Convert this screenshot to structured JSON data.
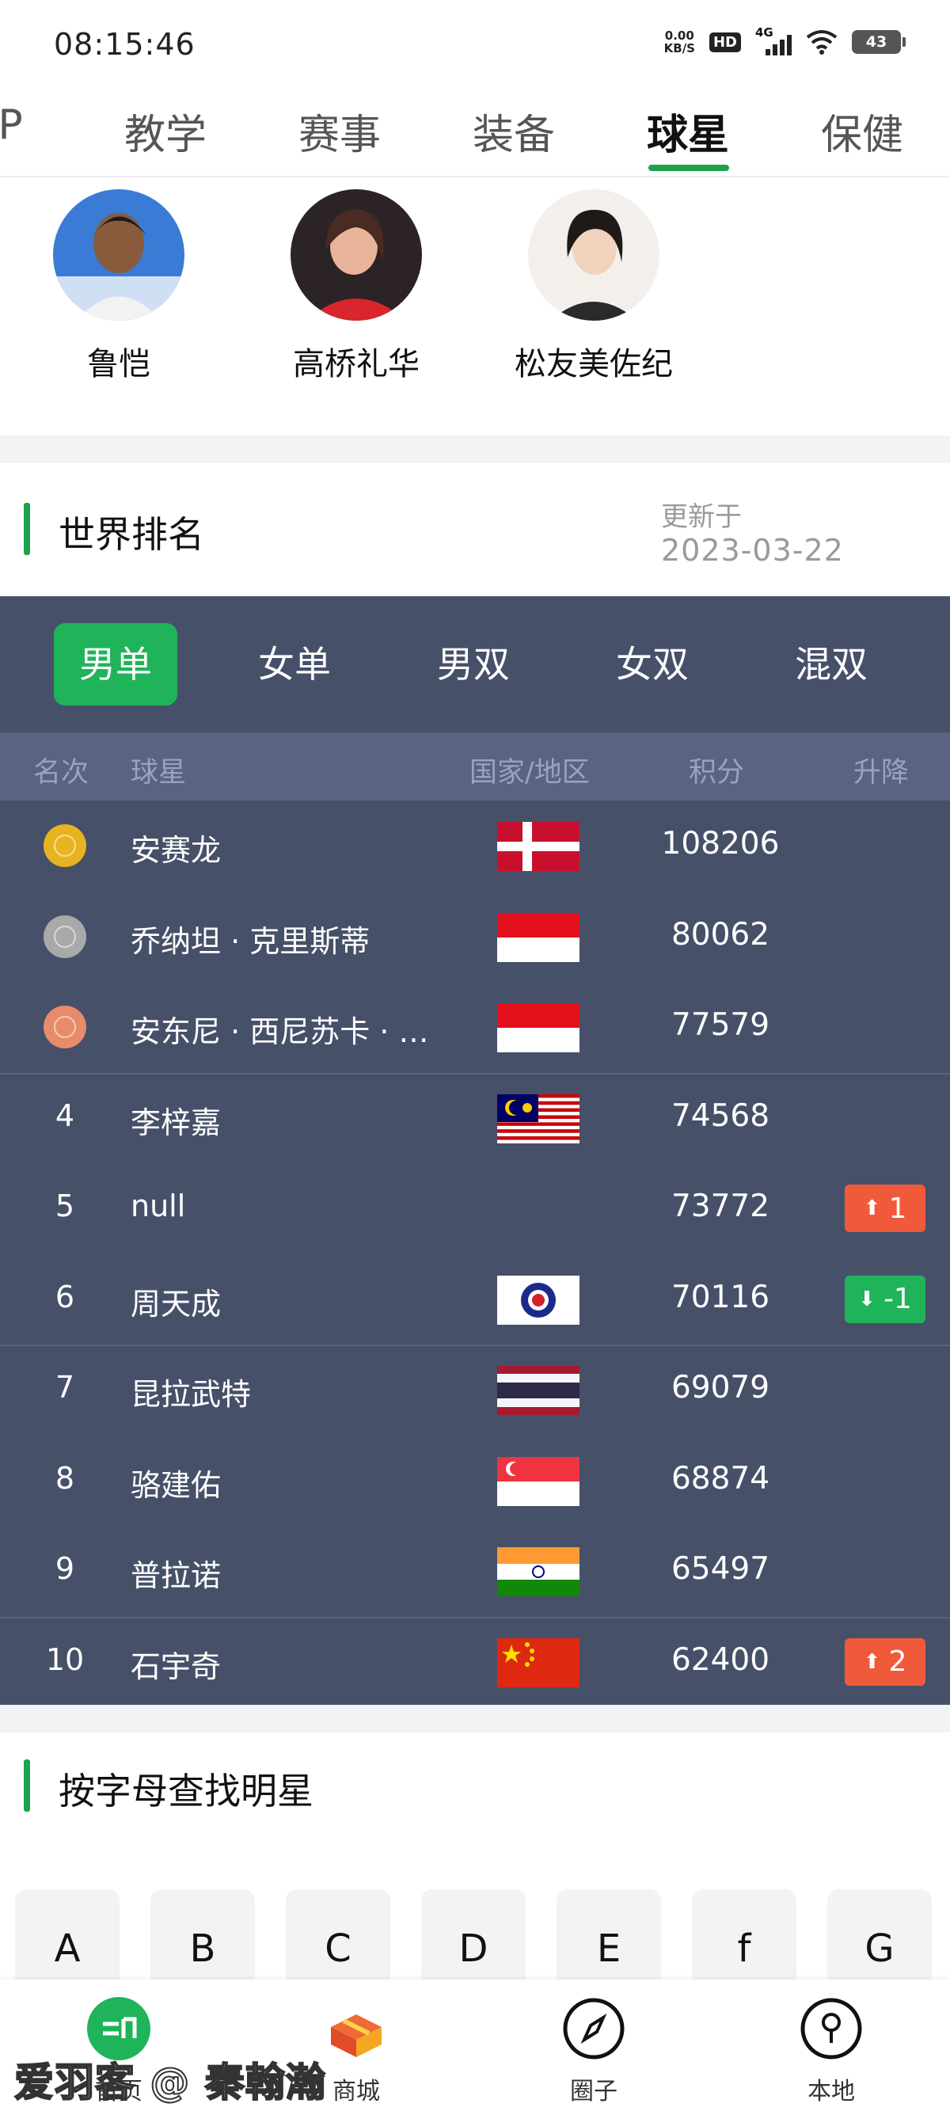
{
  "status_bar": {
    "time": "08:15:46",
    "speed_top": "0.00",
    "speed_bottom": "KB/S",
    "hd": "HD",
    "network": "4G",
    "battery": "43"
  },
  "top_tabs": [
    "IP",
    "教学",
    "赛事",
    "装备",
    "球星",
    "保健"
  ],
  "active_top_tab": "球星",
  "stars": [
    {
      "name": "鲁恺"
    },
    {
      "name": "高桥礼华"
    },
    {
      "name": "松友美佐纪"
    }
  ],
  "ranking": {
    "title": "世界排名",
    "updated_label": "更新于",
    "updated_date": "2023-03-22",
    "segments": [
      "男单",
      "女单",
      "男双",
      "女双",
      "混双"
    ],
    "active_segment": "男单",
    "columns": {
      "rank": "名次",
      "player": "球星",
      "country": "国家/地区",
      "score": "积分",
      "change": "升降"
    },
    "rows": [
      {
        "rank": "1",
        "medal": "gold",
        "name": "安赛龙",
        "flag": "denmark-flag",
        "score": "108206",
        "change": "",
        "direction": ""
      },
      {
        "rank": "2",
        "medal": "silver",
        "name": "乔纳坦 · 克里斯蒂",
        "flag": "indonesia-flag",
        "score": "80062",
        "change": "",
        "direction": ""
      },
      {
        "rank": "3",
        "medal": "bronze",
        "name": "安东尼 · 西尼苏卡 · …",
        "flag": "indonesia-flag",
        "score": "77579",
        "change": "",
        "direction": ""
      },
      {
        "rank": "4",
        "medal": "",
        "name": "李梓嘉",
        "flag": "malaysia-flag",
        "score": "74568",
        "change": "",
        "direction": ""
      },
      {
        "rank": "5",
        "medal": "",
        "name": "null",
        "flag": "",
        "score": "73772",
        "change": "1",
        "direction": "up"
      },
      {
        "rank": "6",
        "medal": "",
        "name": "周天成",
        "flag": "chinese-taipei-flag",
        "score": "70116",
        "change": "-1",
        "direction": "down"
      },
      {
        "rank": "7",
        "medal": "",
        "name": "昆拉武特",
        "flag": "thailand-flag",
        "score": "69079",
        "change": "",
        "direction": ""
      },
      {
        "rank": "8",
        "medal": "",
        "name": "骆建佑",
        "flag": "singapore-flag",
        "score": "68874",
        "change": "",
        "direction": ""
      },
      {
        "rank": "9",
        "medal": "",
        "name": "普拉诺",
        "flag": "india-flag",
        "score": "65497",
        "change": "",
        "direction": ""
      },
      {
        "rank": "10",
        "medal": "",
        "name": "石宇奇",
        "flag": "china-flag",
        "score": "62400",
        "change": "2",
        "direction": "up"
      }
    ]
  },
  "letters": {
    "title": "按字母查找明星",
    "keys": [
      "A",
      "B",
      "C",
      "D",
      "E",
      "f",
      "G"
    ]
  },
  "bottom_nav": [
    {
      "label": "首页",
      "icon": "home-icon"
    },
    {
      "label": "商城",
      "icon": "shop-icon"
    },
    {
      "label": "圈子",
      "icon": "compass-icon"
    },
    {
      "label": "本地",
      "icon": "location-pin-icon"
    }
  ],
  "watermark": "爱羽客 @ 秦翰瀚",
  "colors": {
    "accent": "#1aa34a",
    "panel": "#475069",
    "header_row": "#5a6380",
    "up": "#f05a3a",
    "down": "#1fb45a",
    "gold": "#e8b320",
    "silver": "#a9a9a9",
    "bronze": "#e88b6a"
  }
}
